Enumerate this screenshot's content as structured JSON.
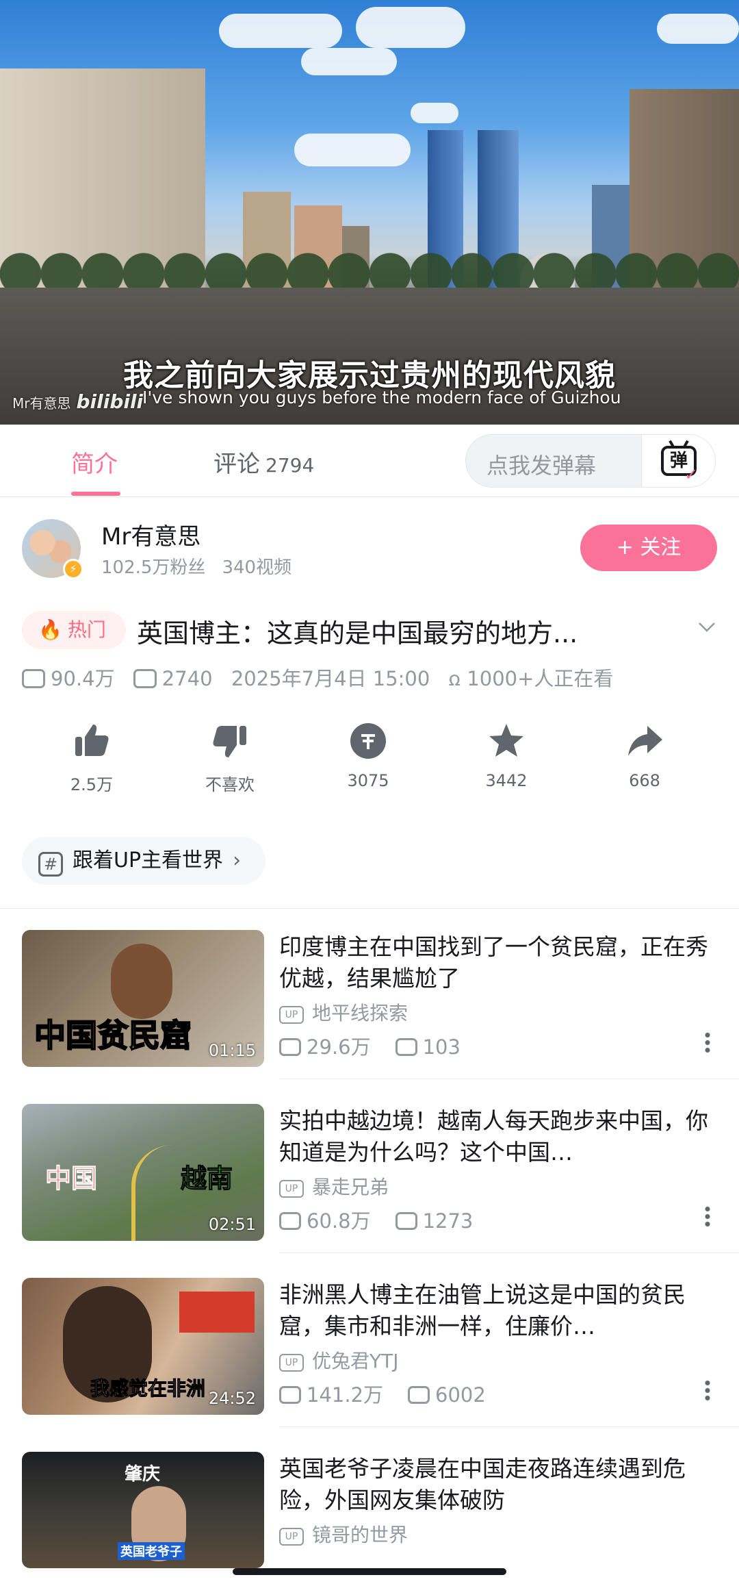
{
  "player": {
    "subtitle_cn": "我之前向大家展示过贵州的现代风貌",
    "subtitle_en": "I've shown you guys before the modern face of Guizhou",
    "watermark_author": "Mr有意思",
    "watermark_logo": "bilibili"
  },
  "tabs": [
    {
      "label": "简介",
      "count": ""
    },
    {
      "label": "评论",
      "count": "2794"
    }
  ],
  "danmaku": {
    "placeholder": "点我发弹幕",
    "button_glyph": "弹"
  },
  "uploader": {
    "name": "Mr有意思",
    "fans": "102.5万粉丝",
    "videos": "340视频",
    "follow_label": "+ 关注"
  },
  "video": {
    "hot_label": "热门",
    "title": "英国博主：这真的是中国最穷的地方...",
    "views": "90.4万",
    "danmaku_count": "2740",
    "publish_time": "2025年7月4日 15:00",
    "watching": "1000+人正在看"
  },
  "actions": [
    {
      "name": "like",
      "label": "2.5万"
    },
    {
      "name": "dislike",
      "label": "不喜欢"
    },
    {
      "name": "coin",
      "label": "3075"
    },
    {
      "name": "favorite",
      "label": "3442"
    },
    {
      "name": "share",
      "label": "668"
    }
  ],
  "topic": {
    "label": "跟着UP主看世界"
  },
  "recommended": [
    {
      "title": "印度博主在中国找到了一个贫民窟，正在秀优越，结果尴尬了",
      "uploader": "地平线探索",
      "views": "29.6万",
      "danmaku": "103",
      "duration": "01:15",
      "caption": "中国贫民窟"
    },
    {
      "title": "实拍中越边境！越南人每天跑步来中国，你知道是为什么吗？这个中国…",
      "uploader": "暴走兄弟",
      "views": "60.8万",
      "danmaku": "1273",
      "duration": "02:51",
      "caption_left": "中国",
      "caption_right": "越南"
    },
    {
      "title": "非洲黑人博主在油管上说这是中国的贫民窟，集市和非洲一样，住廉价…",
      "uploader": "优兔君YTJ",
      "views": "141.2万",
      "danmaku": "6002",
      "duration": "24:52",
      "caption": "我感觉在非洲"
    },
    {
      "title": "英国老爷子凌晨在中国走夜路连续遇到危险，外国网友集体破防",
      "uploader": "镜哥的世界",
      "caption_top": "肇庆",
      "caption": "英国老爷子"
    }
  ],
  "colors": {
    "accent": "#fb7299",
    "text": "#18191c",
    "secondary": "#9499a0"
  }
}
